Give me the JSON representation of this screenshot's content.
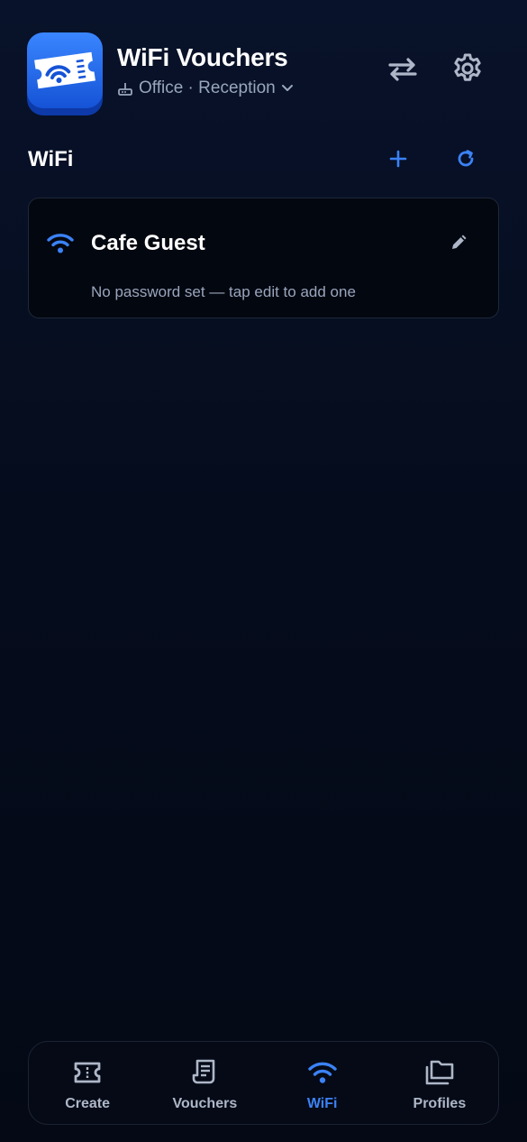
{
  "header": {
    "title": "WiFi Vouchers",
    "site_label": "Office · Reception"
  },
  "section": {
    "title": "WiFi"
  },
  "networks": [
    {
      "name": "Cafe Guest",
      "note": "No password set — tap edit to add one"
    }
  ],
  "bottom_nav": {
    "items": [
      {
        "label": "Create",
        "icon": "ticket-icon",
        "active": false
      },
      {
        "label": "Vouchers",
        "icon": "receipt-icon",
        "active": false
      },
      {
        "label": "WiFi",
        "icon": "wifi-icon",
        "active": true
      },
      {
        "label": "Profiles",
        "icon": "folders-icon",
        "active": false
      }
    ]
  },
  "colors": {
    "background": "#060d1d",
    "accent": "#3b82f6",
    "muted_text": "#9aa6bd",
    "icon_gray": "#aeb7c8"
  }
}
